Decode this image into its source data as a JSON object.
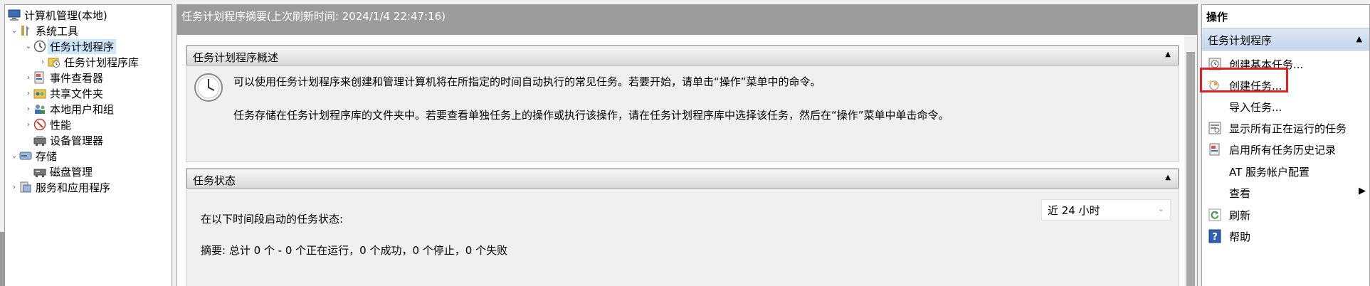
{
  "tree": {
    "items": [
      {
        "label": "计算机管理(本地)",
        "icon": "computer-management-icon"
      },
      {
        "label": "系统工具",
        "icon": "system-tools-icon"
      },
      {
        "label": "任务计划程序",
        "icon": "clock-icon"
      },
      {
        "label": "任务计划程序库",
        "icon": "task-library-icon"
      },
      {
        "label": "事件查看器",
        "icon": "event-viewer-icon"
      },
      {
        "label": "共享文件夹",
        "icon": "shared-folder-icon"
      },
      {
        "label": "本地用户和组",
        "icon": "users-groups-icon"
      },
      {
        "label": "性能",
        "icon": "performance-icon"
      },
      {
        "label": "设备管理器",
        "icon": "device-manager-icon"
      },
      {
        "label": "存储",
        "icon": "storage-icon"
      },
      {
        "label": "磁盘管理",
        "icon": "disk-management-icon"
      },
      {
        "label": "服务和应用程序",
        "icon": "services-apps-icon"
      }
    ]
  },
  "center": {
    "header": "任务计划程序摘要(上次刷新时间: 2024/1/4 22:47:16)",
    "overview": {
      "title": "任务计划程序概述",
      "line1": "可以使用任务计划程序来创建和管理计算机将在所指定的时间自动执行的常见任务。若要开始，请单击“操作”菜单中的命令。",
      "line2": "任务存储在任务计划程序库的文件夹中。若要查看单独任务上的操作或执行该操作，请在任务计划程序库中选择该任务，然后在“操作”菜单中单击命令。"
    },
    "status": {
      "title": "任务状态",
      "period_label": "在以下时间段启动的任务状态:",
      "period_value": "近 24 小时",
      "summary": "摘要: 总计 0 个 - 0 个正在运行，0 个成功，0 个停止，0 个失败"
    }
  },
  "actions": {
    "title": "操作",
    "section": "任务计划程序",
    "items": [
      {
        "label": "创建基本任务...",
        "icon": "create-basic-task-icon"
      },
      {
        "label": "创建任务...",
        "icon": "create-task-icon"
      },
      {
        "label": "导入任务...",
        "icon": ""
      },
      {
        "label": "显示所有正在运行的任务",
        "icon": "running-tasks-icon"
      },
      {
        "label": "启用所有任务历史记录",
        "icon": "task-history-icon"
      },
      {
        "label": "AT 服务帐户配置",
        "icon": ""
      },
      {
        "label": "查看",
        "icon": ""
      },
      {
        "label": "刷新",
        "icon": "refresh-icon"
      },
      {
        "label": "帮助",
        "icon": "help-icon"
      }
    ]
  }
}
